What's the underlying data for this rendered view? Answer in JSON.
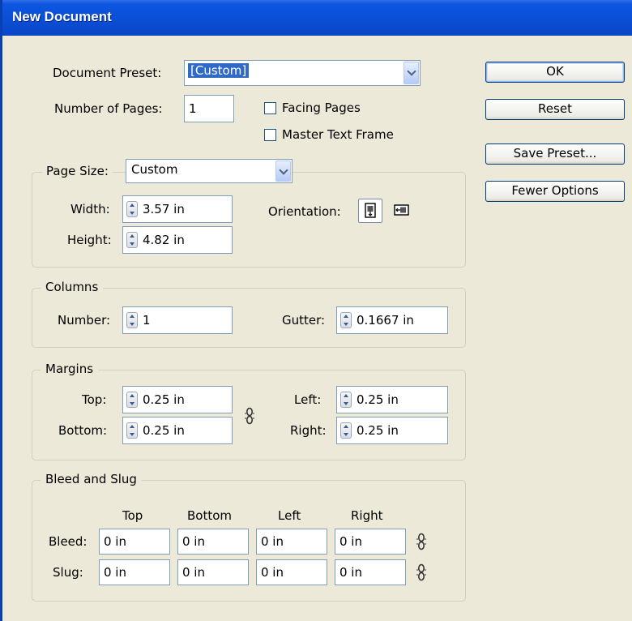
{
  "window": {
    "title": "New Document"
  },
  "preset": {
    "label": "Document Preset:",
    "value": "[Custom]"
  },
  "pages": {
    "label": "Number of Pages:",
    "value": "1"
  },
  "facing_pages": {
    "label": "Facing Pages",
    "checked": false
  },
  "master_text_frame": {
    "label": "Master Text Frame",
    "checked": false
  },
  "page_size": {
    "label": "Page Size:",
    "value": "Custom",
    "width_label": "Width:",
    "width": "3.57 in",
    "height_label": "Height:",
    "height": "4.82 in",
    "orientation_label": "Orientation:",
    "orientation": "portrait",
    "orientation_icons": [
      "portrait-page-icon",
      "landscape-page-icon"
    ]
  },
  "columns": {
    "legend": "Columns",
    "number_label": "Number:",
    "number": "1",
    "gutter_label": "Gutter:",
    "gutter": "0.1667 in"
  },
  "margins": {
    "legend": "Margins",
    "top_label": "Top:",
    "top": "0.25 in",
    "bottom_label": "Bottom:",
    "bottom": "0.25 in",
    "left_label": "Left:",
    "left": "0.25 in",
    "right_label": "Right:",
    "right": "0.25 in",
    "link_icon": "chain-link-icon"
  },
  "bleed_slug": {
    "legend": "Bleed and Slug",
    "headers": [
      "Top",
      "Bottom",
      "Left",
      "Right"
    ],
    "bleed_label": "Bleed:",
    "bleed": [
      "0 in",
      "0 in",
      "0 in",
      "0 in"
    ],
    "slug_label": "Slug:",
    "slug": [
      "0 in",
      "0 in",
      "0 in",
      "0 in"
    ]
  },
  "buttons": {
    "ok": "OK",
    "reset": "Reset",
    "save_preset": "Save Preset...",
    "fewer_options": "Fewer Options"
  },
  "colors": {
    "titlebar": "#0a4fd6",
    "face": "#ece9d8",
    "selection": "#316ac5"
  }
}
